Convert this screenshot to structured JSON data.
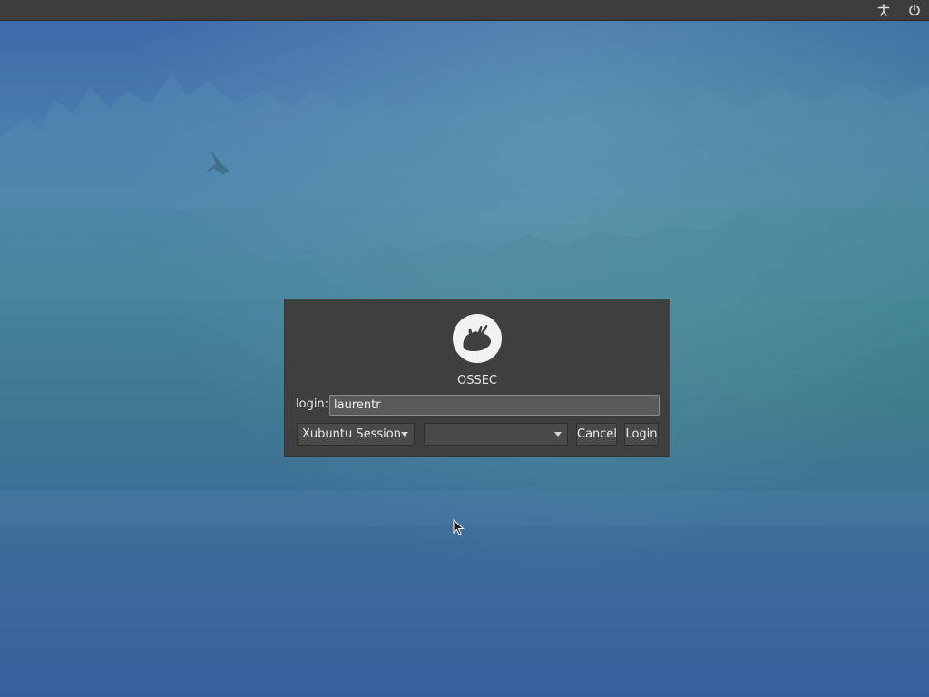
{
  "topbar": {
    "icons": [
      "accessibility-icon",
      "power-icon"
    ]
  },
  "dialog": {
    "logo": "xubuntu-mouse-logo",
    "hostname": "OSSEC",
    "login_label": "login:",
    "login_value": "laurentr",
    "session_selected": "Xubuntu Session",
    "language_selected": "",
    "cancel_label": "Cancel",
    "login_button_label": "Login"
  },
  "colors": {
    "panel": "#3c3c3c",
    "dialog": "#3f3f3f",
    "wallpaper": "#3f7890"
  }
}
